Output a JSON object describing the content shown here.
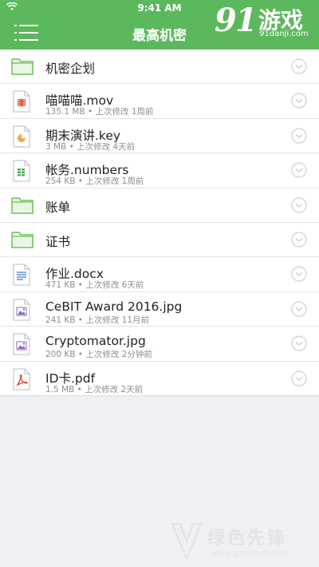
{
  "status": {
    "time": "9:41 AM",
    "wifi_icon": "wifi-icon"
  },
  "nav": {
    "title": "最高机密",
    "menu_icon": "hamburger-menu-icon"
  },
  "logo": {
    "brand_num": "91",
    "brand_cn": "游戏",
    "url": "91danji.com"
  },
  "colors": {
    "accent": "#5cb85c",
    "background": "#efeff4"
  },
  "items": [
    {
      "type": "folder",
      "icon": "folder-icon",
      "name": "机密企划",
      "meta": ""
    },
    {
      "type": "file",
      "icon": "video-file-icon",
      "name": "喵喵喵.mov",
      "meta": "135.1 MB • 上次修改 1周前"
    },
    {
      "type": "file",
      "icon": "keynote-file-icon",
      "name": "期末演讲.key",
      "meta": "3 MB • 上次修改 4天前"
    },
    {
      "type": "file",
      "icon": "numbers-file-icon",
      "name": "帐务.numbers",
      "meta": "254 KB • 上次修改 1周前"
    },
    {
      "type": "folder",
      "icon": "folder-icon",
      "name": "账单",
      "meta": ""
    },
    {
      "type": "folder",
      "icon": "folder-icon",
      "name": "证书",
      "meta": ""
    },
    {
      "type": "file",
      "icon": "document-file-icon",
      "name": "作业.docx",
      "meta": "471 KB • 上次修改 6天前"
    },
    {
      "type": "file",
      "icon": "image-file-icon",
      "name": "CeBIT Award 2016.jpg",
      "meta": "241 KB • 上次修改 11月前"
    },
    {
      "type": "file",
      "icon": "image-file-icon",
      "name": "Cryptomator.jpg",
      "meta": "200 KB • 上次修改 2分钟前"
    },
    {
      "type": "file",
      "icon": "pdf-file-icon",
      "name": "ID卡.pdf",
      "meta": "1.5 MB • 上次修改 2天前"
    }
  ],
  "watermark": {
    "text": "绿色先锋",
    "url": "www.greenxf.com"
  }
}
